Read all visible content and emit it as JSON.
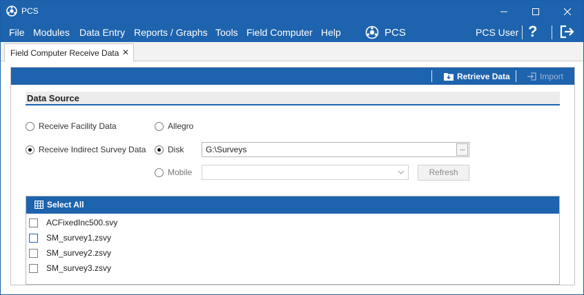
{
  "window": {
    "title": "PCS",
    "accent_color": "#1e63ad"
  },
  "menu": {
    "items": [
      "File",
      "Modules",
      "Data Entry",
      "Reports / Graphs",
      "Tools",
      "Field Computer",
      "Help"
    ],
    "center_brand": "PCS",
    "user": "PCS User",
    "help_glyph": "?"
  },
  "tabs": [
    {
      "label": "Field Computer Receive Data",
      "close_glyph": "✕"
    }
  ],
  "toolbar": {
    "retrieve_label": "Retrieve Data",
    "import_label": "Import"
  },
  "data_source": {
    "heading": "Data Source",
    "receive_options": [
      {
        "label": "Receive Facility Data",
        "checked": false
      },
      {
        "label": "Receive Indirect Survey Data",
        "checked": true
      }
    ],
    "device_options": [
      {
        "label": "Allegro",
        "checked": false
      },
      {
        "label": "Disk",
        "checked": true
      },
      {
        "label": "Mobile",
        "checked": false
      }
    ],
    "disk_path": "G:\\Surveys",
    "browse_glyph": "···",
    "mobile_selected": "",
    "refresh_label": "Refresh"
  },
  "file_list": {
    "select_all_label": "Select All",
    "files": [
      {
        "name": "ACFixedInc500.svy",
        "checked": false
      },
      {
        "name": "SM_survey1.zsvy",
        "checked": false
      },
      {
        "name": "SM_survey2.zsvy",
        "checked": false
      },
      {
        "name": "SM_survey3.zsvy",
        "checked": false
      }
    ]
  }
}
